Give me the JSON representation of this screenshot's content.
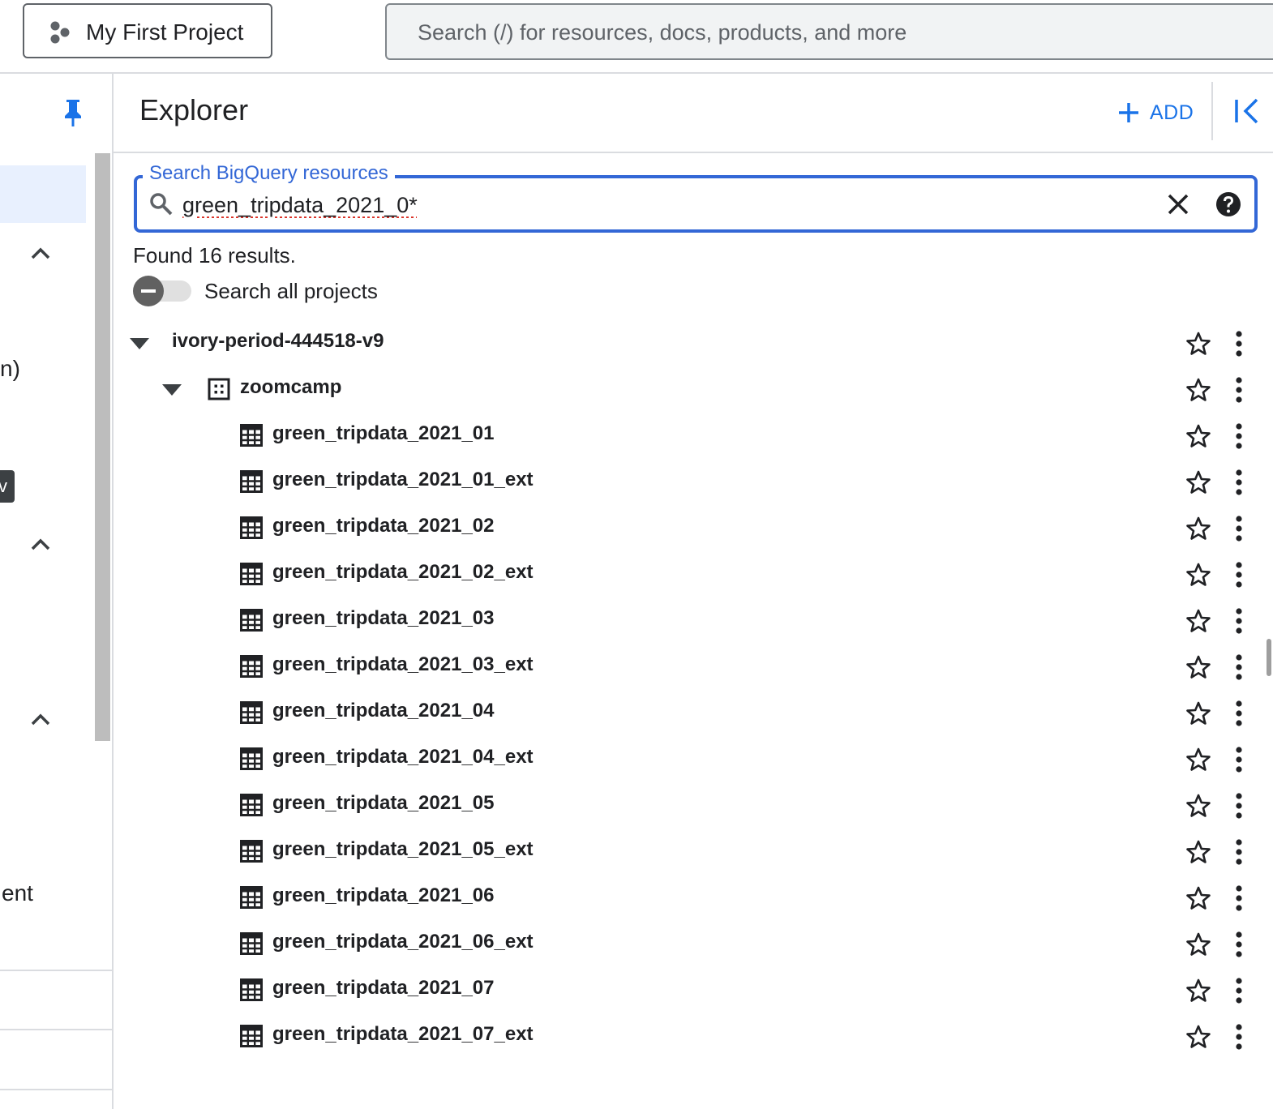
{
  "topbar": {
    "project_name": "My First Project",
    "search_placeholder": "Search (/) for resources, docs, products, and more"
  },
  "left_rail": {
    "fragments": [
      "n)",
      "v",
      "ent"
    ]
  },
  "explorer": {
    "title": "Explorer",
    "add_label": "ADD"
  },
  "bq_search": {
    "label": "Search BigQuery resources",
    "value": "green_tripdata_2021_0*",
    "results_text": "Found 16 results.",
    "toggle_label": "Search all projects"
  },
  "tree": {
    "project": "ivory-period-444518-v9",
    "dataset": "zoomcamp",
    "tables": [
      "green_tripdata_2021_01",
      "green_tripdata_2021_01_ext",
      "green_tripdata_2021_02",
      "green_tripdata_2021_02_ext",
      "green_tripdata_2021_03",
      "green_tripdata_2021_03_ext",
      "green_tripdata_2021_04",
      "green_tripdata_2021_04_ext",
      "green_tripdata_2021_05",
      "green_tripdata_2021_05_ext",
      "green_tripdata_2021_06",
      "green_tripdata_2021_06_ext",
      "green_tripdata_2021_07",
      "green_tripdata_2021_07_ext"
    ]
  },
  "colors": {
    "accent": "#1a73e8",
    "focus_border": "#3367d6",
    "selected_bg": "#e8f0fe"
  }
}
